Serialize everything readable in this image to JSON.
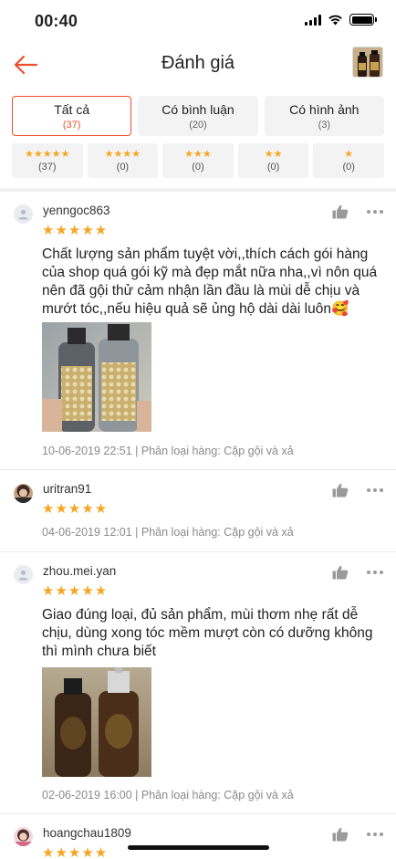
{
  "status_bar": {
    "time": "00:40"
  },
  "header": {
    "title": "Đánh giá"
  },
  "filters": [
    {
      "label": "Tất cả",
      "count": "(37)",
      "active": true
    },
    {
      "label": "Có bình luận",
      "count": "(20)",
      "active": false
    },
    {
      "label": "Có hình ảnh",
      "count": "(3)",
      "active": false
    }
  ],
  "star_filters": [
    {
      "stars": "★★★★★",
      "count": "(37)"
    },
    {
      "stars": "★★★★",
      "count": "(0)"
    },
    {
      "stars": "★★★",
      "count": "(0)"
    },
    {
      "stars": "★★",
      "count": "(0)"
    },
    {
      "stars": "★",
      "count": "(0)"
    }
  ],
  "reviews": [
    {
      "username": "yenngoc863",
      "rating": "★★★★★",
      "comment": "Chất lượng sản phẩm tuyệt vời,,thích cách gói hàng của shop quá gói kỹ mà đẹp mắt nữa nha,,vì nôn quá nên đã gội thử cảm nhận lần đầu là mùi dễ chịu và mướt tóc,,nếu hiệu quả sẽ ủng hộ dài dài luôn🥰",
      "meta": "10-06-2019 22:51 | Phân loại hàng: Cặp gội và xả"
    },
    {
      "username": "uritran91",
      "rating": "★★★★★",
      "meta": "04-06-2019 12:01 | Phân loại hàng: Cặp gội và xả"
    },
    {
      "username": "zhou.mei.yan",
      "rating": "★★★★★",
      "comment": "Giao đúng loại, đủ sản phẩm, mùi thơm nhẹ rất dễ chịu, dùng xong tóc mềm mượt còn có dưỡng không thì mình chưa biết",
      "meta": "02-06-2019 16:00 | Phân loại hàng: Cặp gội và xả"
    },
    {
      "username": "hoangchau1809",
      "rating": "★★★★★"
    }
  ],
  "colors": {
    "accent": "#ee4d2d",
    "star": "#f5a623"
  }
}
